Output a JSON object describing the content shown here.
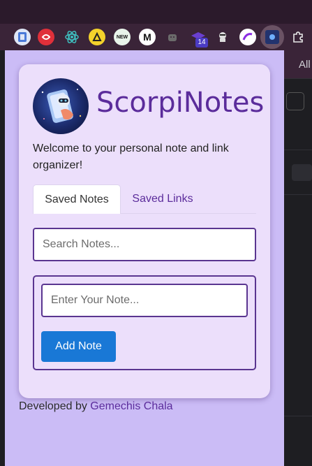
{
  "app": {
    "title": "ScorpiNotes",
    "welcome": "Welcome to your personal note and link organizer!"
  },
  "tabs": [
    {
      "label": "Saved Notes",
      "active": true
    },
    {
      "label": "Saved Links",
      "active": false
    }
  ],
  "search": {
    "placeholder": "Search Notes..."
  },
  "note": {
    "placeholder": "Enter Your Note...",
    "add_label": "Add Note"
  },
  "footer": {
    "prefix": "Developed by",
    "author": "Gemechis Chala"
  },
  "browser": {
    "extensions": [
      {
        "icon": "document-icon"
      },
      {
        "icon": "red-circle-icon"
      },
      {
        "icon": "react-icon"
      },
      {
        "icon": "yellow-triangle-icon"
      },
      {
        "icon": "new-badge-icon"
      },
      {
        "icon": "medium-icon"
      },
      {
        "icon": "android-icon"
      },
      {
        "icon": "cap-icon",
        "badge": "14"
      },
      {
        "icon": "hacker-icon"
      },
      {
        "icon": "arc-icon"
      },
      {
        "icon": "scorpinotes-icon"
      },
      {
        "icon": "puzzle-icon"
      }
    ],
    "background_text": "All"
  },
  "colors": {
    "accent": "#5b2c9b",
    "button": "#1978d6",
    "popup_bg": "#cbbcf6",
    "card_bg": "#ecdffb",
    "input_border": "#5a3590"
  }
}
